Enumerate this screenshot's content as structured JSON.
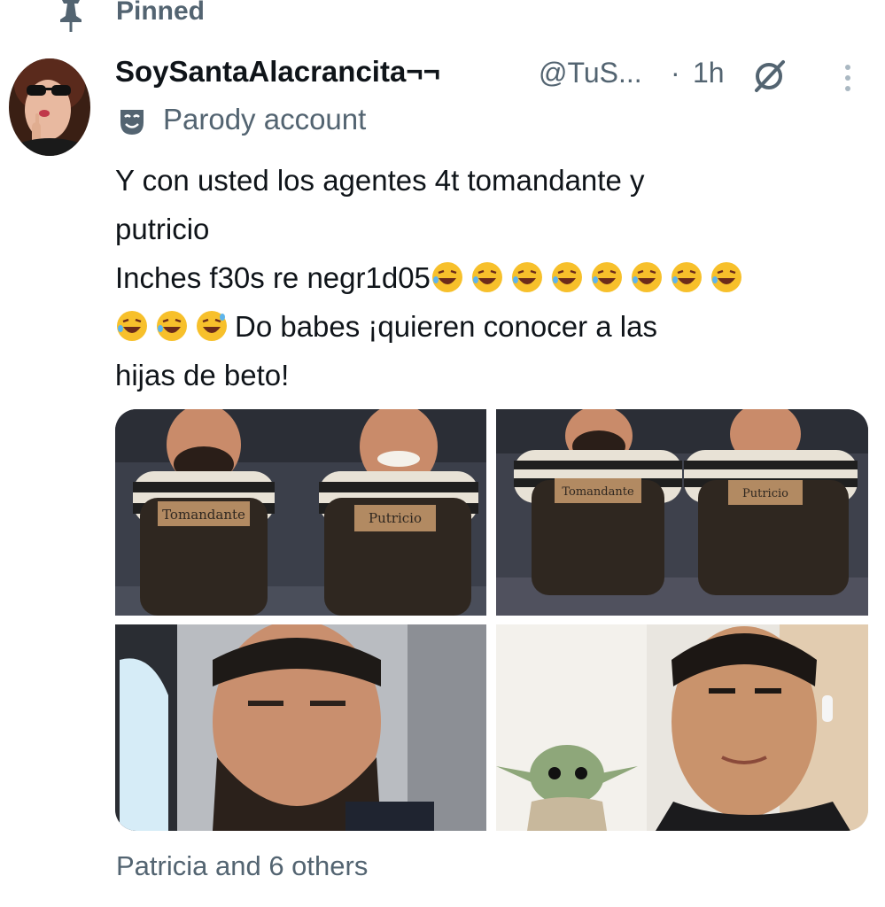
{
  "pinned": {
    "label": "Pinned",
    "icon": "pin-icon"
  },
  "author": {
    "display_name": "SoySantaAlacrancita¬¬",
    "handle": "@TuS...",
    "separator": "·",
    "time": "1h",
    "badge_icon": "parody-mask-icon",
    "badge": "Parody account"
  },
  "tweet": {
    "line1": "Y con usted los agentes 4t tomandante y",
    "line2": "putricio",
    "line3_text": "Inches f30s re negr1d05",
    "line3_emojis": [
      "🤣",
      "🤣",
      "🤣",
      "🤣",
      "🤣",
      "🤣",
      "🤣",
      "🤣"
    ],
    "line4_emojis": [
      "🤣",
      "😂",
      "😅"
    ],
    "line4_text": "Do babes ¡quieren conocer a las",
    "line5": "hijas de beto!"
  },
  "media": {
    "image1": {
      "label_left": "Tomandante",
      "label_right": "Putricio"
    },
    "image2": {
      "label_left": "Tomandante",
      "label_right": "Putricio"
    }
  },
  "engagement": {
    "liked_by": "Patricia and 6 others"
  },
  "colors": {
    "secondary_text": "#536471",
    "primary_text": "#0f1419",
    "emoji_yellow": "#f7c02b"
  }
}
